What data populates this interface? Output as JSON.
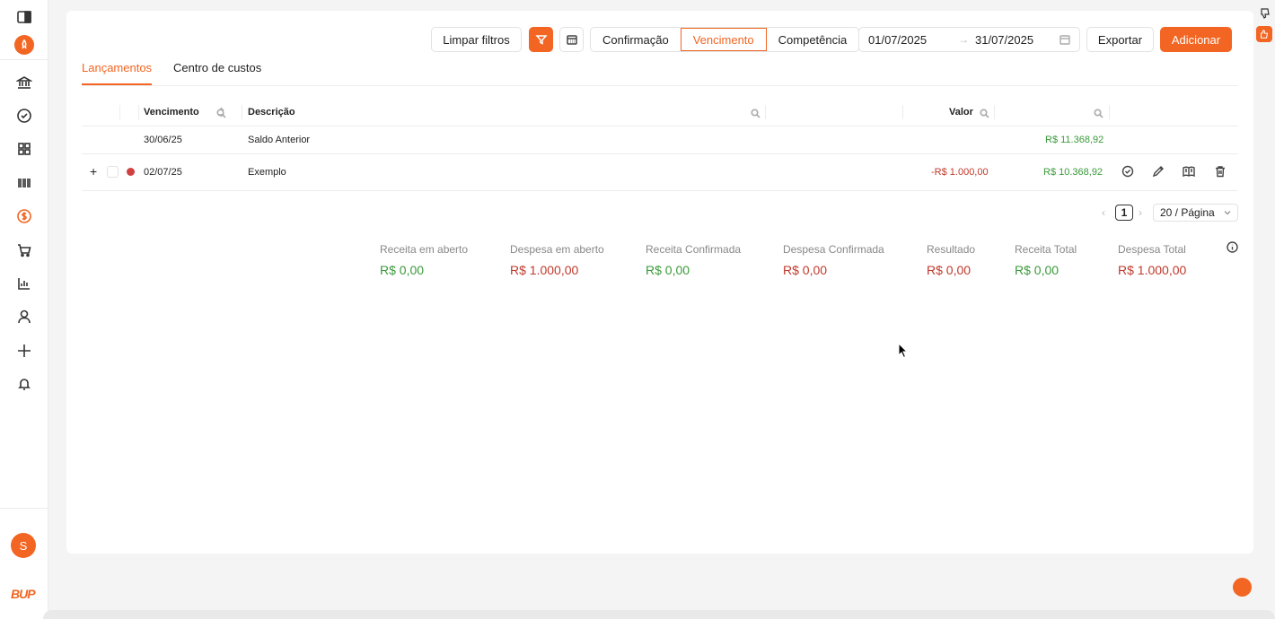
{
  "sidebar": {
    "items": [
      "sidebar-toggle-icon",
      "bank-icon",
      "check-circle-icon",
      "grid-icon",
      "barcode-icon",
      "dollar-icon",
      "cart-icon",
      "bar-chart-icon",
      "user-icon",
      "plus-icon",
      "bell-icon"
    ],
    "avatar_initial": "S",
    "brand": "BUP"
  },
  "toolbar": {
    "clear_filters": "Limpar filtros",
    "segments": [
      "Confirmação",
      "Vencimento",
      "Competência"
    ],
    "active_segment": "Vencimento",
    "date_start": "01/07/2025",
    "date_end": "31/07/2025",
    "date_separator": "→",
    "export": "Exportar",
    "add": "Adicionar"
  },
  "tabs": [
    {
      "label": "Lançamentos",
      "active": true
    },
    {
      "label": "Centro de custos",
      "active": false
    }
  ],
  "table": {
    "columns": [
      "Vencimento",
      "Descrição",
      "Valor"
    ],
    "rows": [
      {
        "date": "30/06/25",
        "description": "Saldo Anterior",
        "value": "",
        "balance": "R$ 11.368,92"
      },
      {
        "expand": "+",
        "status_color": "#d04040",
        "date": "02/07/25",
        "description": "Exemplo",
        "value": "-R$ 1.000,00",
        "balance": "R$ 10.368,92"
      }
    ]
  },
  "pagination": {
    "prev": "‹",
    "current": "1",
    "next": "›",
    "page_size": "20 / Página"
  },
  "summary": [
    {
      "label": "Receita em aberto",
      "value": "R$ 0,00",
      "color": "green"
    },
    {
      "label": "Despesa em aberto",
      "value": "R$ 1.000,00",
      "color": "red"
    },
    {
      "label": "Receita Confirmada",
      "value": "R$ 0,00",
      "color": "green"
    },
    {
      "label": "Despesa Confirmada",
      "value": "R$ 0,00",
      "color": "red"
    },
    {
      "label": "Resultado",
      "value": "R$ 0,00",
      "color": "red"
    },
    {
      "label": "Receita Total",
      "value": "R$ 0,00",
      "color": "green"
    },
    {
      "label": "Despesa Total",
      "value": "R$ 1.000,00",
      "color": "red"
    }
  ],
  "colors": {
    "accent": "#f26522",
    "positive": "#3a9a3a",
    "negative": "#c0392b"
  }
}
